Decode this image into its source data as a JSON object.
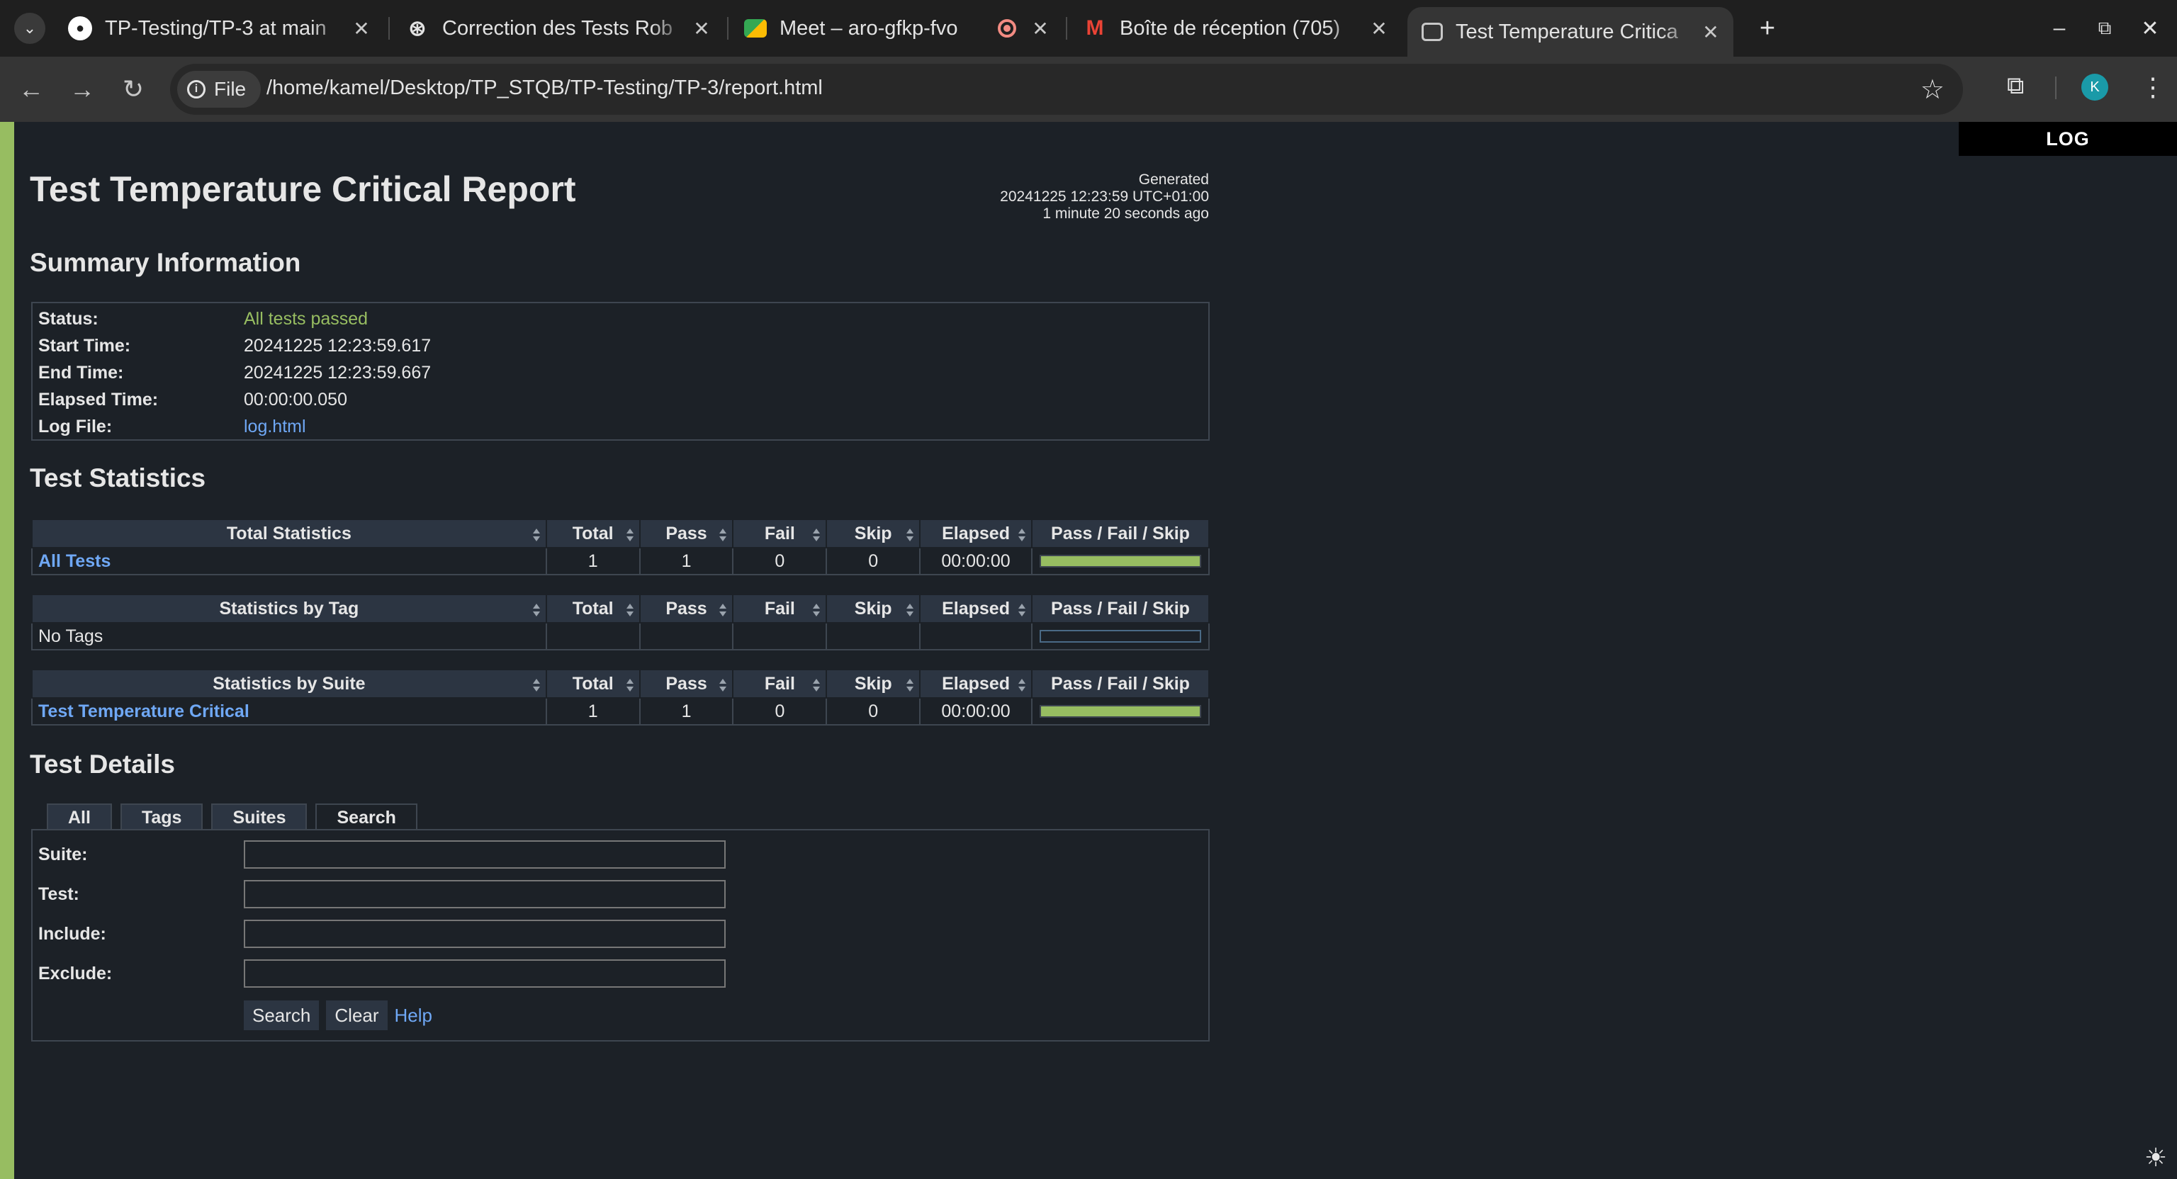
{
  "browser": {
    "tabs": [
      {
        "title": "TP-Testing/TP-3 at main",
        "icon": "github-icon"
      },
      {
        "title": "Correction des Tests Rob",
        "icon": "globe-icon"
      },
      {
        "title": "Meet – aro-gfkp-fvo",
        "icon": "meet-icon",
        "recording": true
      },
      {
        "title": "Boîte de réception (705)",
        "icon": "gmail-icon"
      },
      {
        "title": "Test Temperature Critica",
        "icon": "page-icon",
        "active": true
      }
    ],
    "url_scheme_label": "File",
    "url": "/home/kamel/Desktop/TP_STQB/TP-Testing/TP-3/report.html",
    "profile_initial": "K",
    "profile_color": "#1a9aa8"
  },
  "report": {
    "log_link": "LOG",
    "title": "Test Temperature Critical Report",
    "generated_label": "Generated",
    "generated_time": "20241225 12:23:59 UTC+01:00",
    "generated_ago": "1 minute 20 seconds ago",
    "colors": {
      "pass": "#97bd61",
      "link": "#6fa8f5",
      "background": "#1c2127"
    }
  },
  "summary": {
    "heading": "Summary Information",
    "rows": [
      {
        "label": "Status:",
        "value": "All tests passed"
      },
      {
        "label": "Start Time:",
        "value": "20241225 12:23:59.617"
      },
      {
        "label": "End Time:",
        "value": "20241225 12:23:59.667"
      },
      {
        "label": "Elapsed Time:",
        "value": "00:00:00.050"
      },
      {
        "label": "Log File:",
        "value": "log.html"
      }
    ]
  },
  "statistics": {
    "heading": "Test Statistics",
    "columns": [
      "Total",
      "Pass",
      "Fail",
      "Skip",
      "Elapsed",
      "Pass / Fail / Skip"
    ],
    "total": {
      "header": "Total Statistics",
      "row": {
        "name": "All Tests",
        "total": "1",
        "pass": "1",
        "fail": "0",
        "skip": "0",
        "elapsed": "00:00:00",
        "pass_fraction": 1.0
      }
    },
    "by_tag": {
      "header": "Statistics by Tag",
      "row": {
        "name": "No Tags",
        "total": "",
        "pass": "",
        "fail": "",
        "skip": "",
        "elapsed": "",
        "pass_fraction": 0
      }
    },
    "by_suite": {
      "header": "Statistics by Suite",
      "row": {
        "name": "Test Temperature Critical",
        "total": "1",
        "pass": "1",
        "fail": "0",
        "skip": "0",
        "elapsed": "00:00:00",
        "pass_fraction": 1.0
      }
    }
  },
  "details": {
    "heading": "Test Details",
    "tabs": [
      "All",
      "Tags",
      "Suites",
      "Search"
    ],
    "active_tab": "Search",
    "fields": [
      {
        "label": "Suite:",
        "value": ""
      },
      {
        "label": "Test:",
        "value": ""
      },
      {
        "label": "Include:",
        "value": ""
      },
      {
        "label": "Exclude:",
        "value": ""
      }
    ],
    "search_button": "Search",
    "clear_button": "Clear",
    "help_link": "Help"
  }
}
